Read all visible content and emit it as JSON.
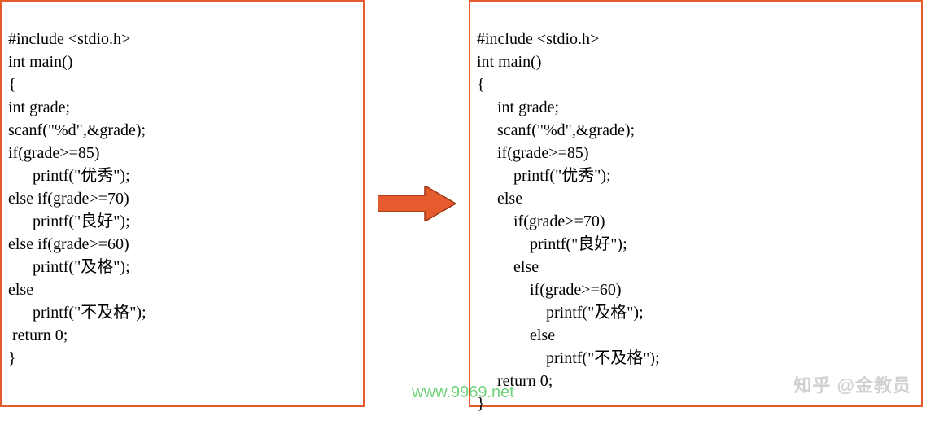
{
  "code": {
    "left": {
      "l1": "#include <stdio.h>",
      "l2": "int main()",
      "l3": "{",
      "l4": "int grade;",
      "l5": "scanf(\"%d\",&grade);",
      "l6": "if(grade>=85)",
      "l7": "      printf(\"优秀\");",
      "l8": "else if(grade>=70)",
      "l9": "      printf(\"良好\");",
      "l10": "else if(grade>=60)",
      "l11": "      printf(\"及格\");",
      "l12": "else",
      "l13": "      printf(\"不及格\");",
      "l14": " return 0;",
      "l15": "}"
    },
    "right": {
      "l1": "#include <stdio.h>",
      "l2": "int main()",
      "l3": "{",
      "l4": "     int grade;",
      "l5": "     scanf(\"%d\",&grade);",
      "l6": "     if(grade>=85)",
      "l7": "         printf(\"优秀\");",
      "l8": "     else",
      "l9": "         if(grade>=70)",
      "l10": "             printf(\"良好\");",
      "l11": "         else",
      "l12": "             if(grade>=60)",
      "l13": "                 printf(\"及格\");",
      "l14": "             else",
      "l15": "                 printf(\"不及格\");",
      "l16": "     return 0;",
      "l17": "}"
    }
  },
  "watermark": {
    "center": "www.9969.net",
    "right": "知乎 @金教员"
  },
  "colors": {
    "panel_border": "#e55b2d",
    "arrow": "#e55b2d"
  }
}
